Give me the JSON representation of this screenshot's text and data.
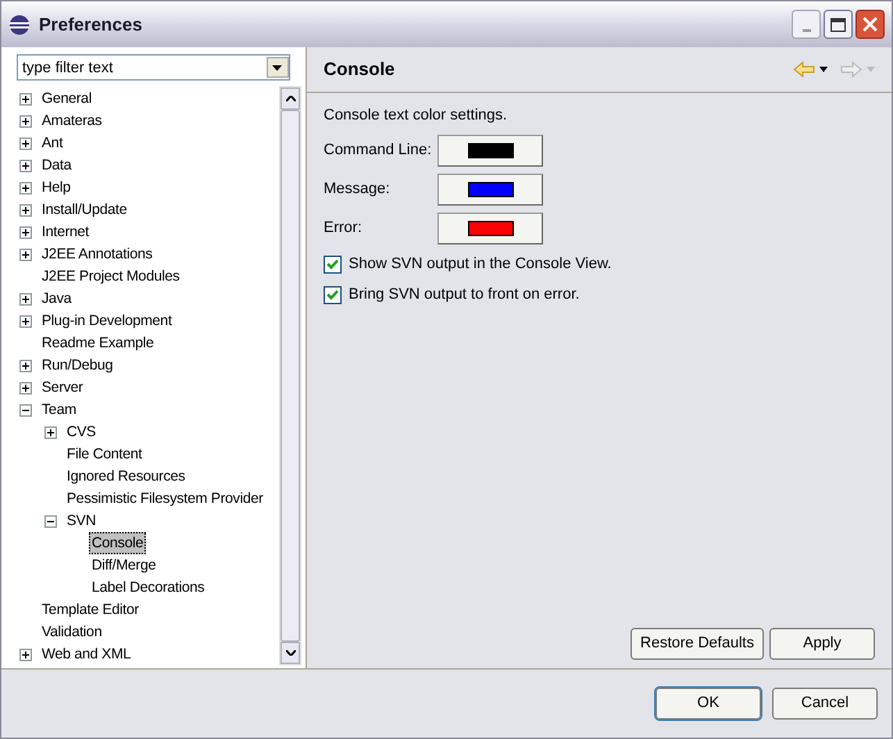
{
  "window": {
    "title": "Preferences"
  },
  "filter": {
    "placeholder": "type filter text"
  },
  "tree": [
    {
      "label": "General",
      "expanded": false,
      "selected": false
    },
    {
      "label": "Amateras",
      "expanded": false,
      "selected": false
    },
    {
      "label": "Ant",
      "expanded": false,
      "selected": false
    },
    {
      "label": "Data",
      "expanded": false,
      "selected": false
    },
    {
      "label": "Help",
      "expanded": false,
      "selected": false
    },
    {
      "label": "Install/Update",
      "expanded": false,
      "selected": false
    },
    {
      "label": "Internet",
      "expanded": false,
      "selected": false
    },
    {
      "label": "J2EE Annotations",
      "expanded": false,
      "selected": false
    },
    {
      "label": "J2EE Project Modules",
      "selected": false
    },
    {
      "label": "Java",
      "expanded": false,
      "selected": false
    },
    {
      "label": "Plug-in Development",
      "expanded": false,
      "selected": false
    },
    {
      "label": "Readme Example",
      "selected": false
    },
    {
      "label": "Run/Debug",
      "expanded": false,
      "selected": false
    },
    {
      "label": "Server",
      "expanded": false,
      "selected": false
    },
    {
      "label": "Team",
      "expanded": true,
      "selected": false,
      "children": [
        {
          "label": "CVS",
          "expanded": false,
          "selected": false
        },
        {
          "label": "File Content",
          "selected": false
        },
        {
          "label": "Ignored Resources",
          "selected": false
        },
        {
          "label": "Pessimistic Filesystem Provider",
          "selected": false
        },
        {
          "label": "SVN",
          "expanded": true,
          "selected": false,
          "children": [
            {
              "label": "Console",
              "selected": true
            },
            {
              "label": "Diff/Merge",
              "selected": false
            },
            {
              "label": "Label Decorations",
              "selected": false
            }
          ]
        }
      ]
    },
    {
      "label": "Template Editor",
      "selected": false
    },
    {
      "label": "Validation",
      "selected": false
    },
    {
      "label": "Web and XML",
      "expanded": false,
      "selected": false
    }
  ],
  "page": {
    "title": "Console",
    "description": "Console text color settings.",
    "colors": [
      {
        "label": "Command Line:",
        "color": "#000000"
      },
      {
        "label": "Message:",
        "color": "#0000ff"
      },
      {
        "label": "Error:",
        "color": "#ff0000"
      }
    ],
    "options": [
      {
        "label": "Show SVN output in the Console View.",
        "checked": true
      },
      {
        "label": "Bring SVN output to front on error.",
        "checked": true
      }
    ],
    "buttons": [
      "Restore Defaults",
      "Apply"
    ]
  },
  "footer_buttons": [
    "OK",
    "Cancel"
  ]
}
